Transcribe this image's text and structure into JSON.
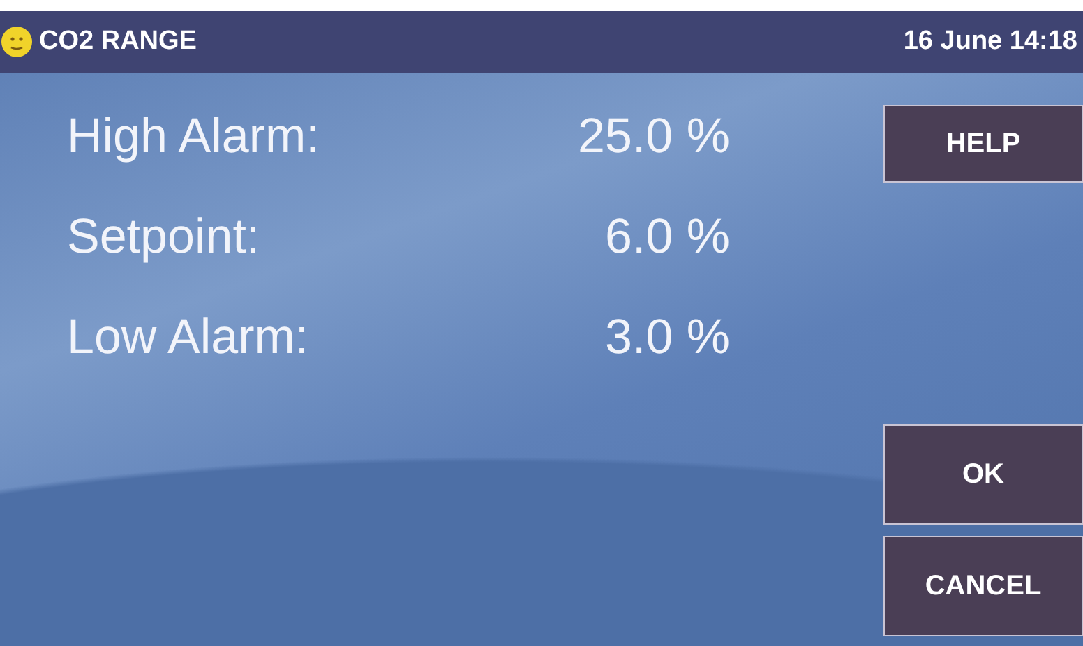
{
  "header": {
    "title": "CO2 RANGE",
    "datetime": "16 June 14:18"
  },
  "settings": [
    {
      "label": "High Alarm:",
      "value": "25.0 %"
    },
    {
      "label": "Setpoint:",
      "value": "6.0 %"
    },
    {
      "label": "Low Alarm:",
      "value": "3.0 %"
    }
  ],
  "side_buttons": [
    "HELP"
  ],
  "bottom_buttons": [
    "OK",
    "CANCEL"
  ]
}
